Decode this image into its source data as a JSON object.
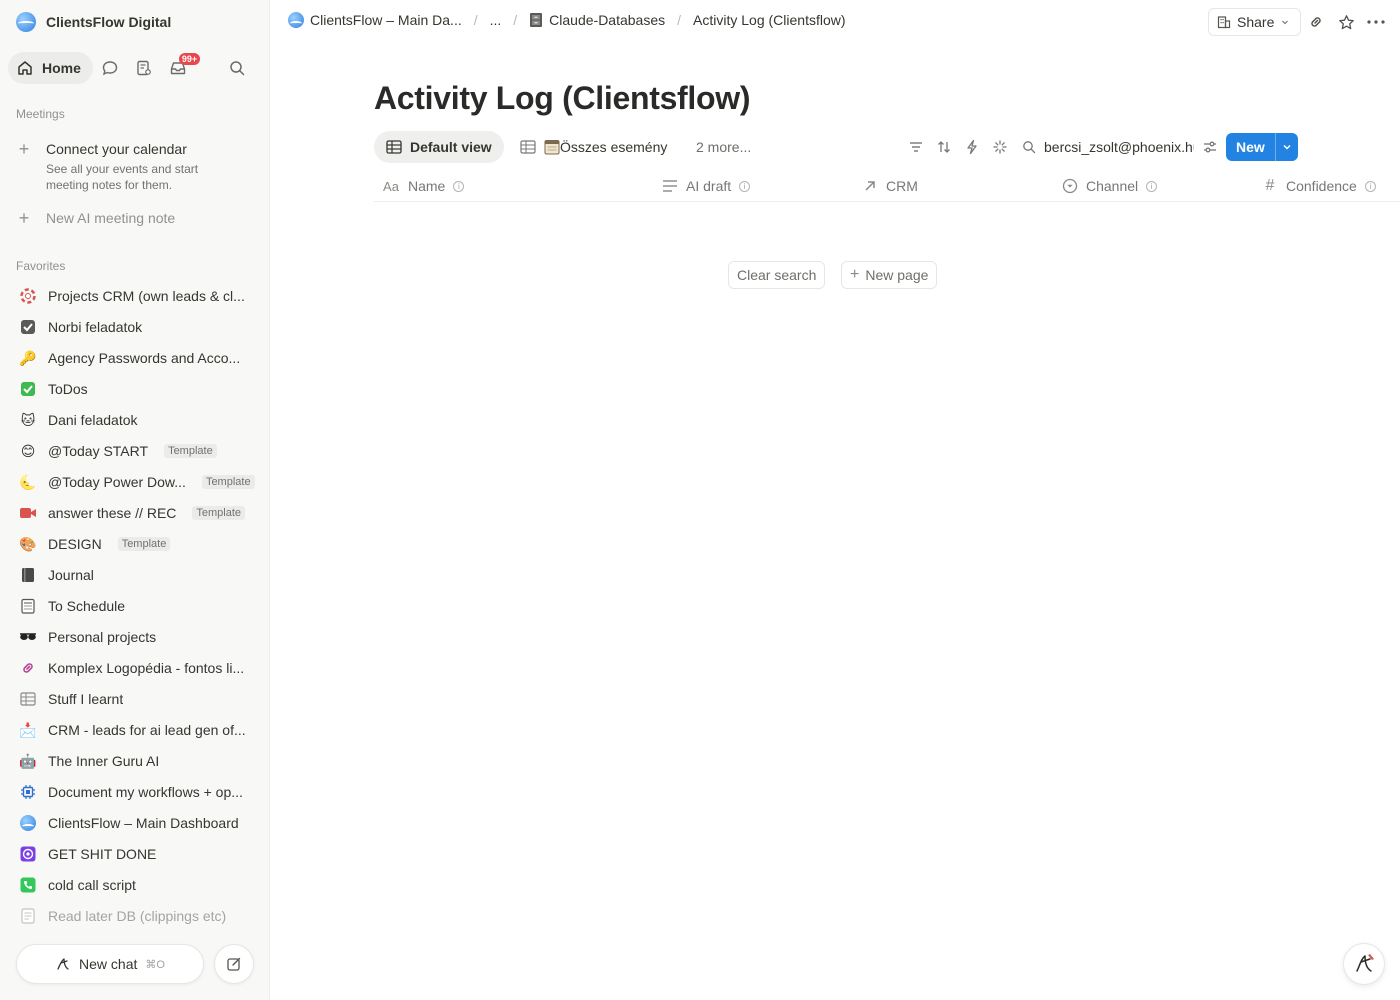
{
  "workspace": {
    "name": "ClientsFlow Digital"
  },
  "nav": {
    "home_label": "Home",
    "inbox_badge": "99+"
  },
  "meetings": {
    "section_label": "Meetings",
    "connect_title": "Connect your calendar",
    "connect_desc": "See all your events and start meeting notes for them.",
    "new_note": "New AI meeting note"
  },
  "favorites": {
    "section_label": "Favorites",
    "template_tag": "Template",
    "items": [
      {
        "label": "Projects CRM (own leads & cl...",
        "icon": "lifebuoy-icon"
      },
      {
        "label": "Norbi feladatok",
        "icon": "checkbox-icon"
      },
      {
        "label": "Agency Passwords and Acco...",
        "icon": "key-icon"
      },
      {
        "label": "ToDos",
        "icon": "check-mark-icon"
      },
      {
        "label": "Dani feladatok",
        "icon": "cat-icon"
      },
      {
        "label": "@Today START",
        "icon": "smile-icon"
      },
      {
        "label": "@Today Power Dow...",
        "icon": "moon-icon"
      },
      {
        "label": "answer these // REC",
        "icon": "video-camera-icon"
      },
      {
        "label": "DESIGN",
        "icon": "palette-icon"
      },
      {
        "label": "Journal",
        "icon": "notebook-icon"
      },
      {
        "label": "To Schedule",
        "icon": "calendar-icon"
      },
      {
        "label": "Personal projects",
        "icon": "sunglasses-icon"
      },
      {
        "label": "Komplex Logopédia - fontos li...",
        "icon": "link-icon"
      },
      {
        "label": "Stuff I learnt",
        "icon": "table-icon"
      },
      {
        "label": "CRM - leads for ai lead gen of...",
        "icon": "inbox-tray-icon"
      },
      {
        "label": "The Inner Guru AI",
        "icon": "robot-icon"
      },
      {
        "label": "Document my workflows + op...",
        "icon": "chip-icon"
      },
      {
        "label": "ClientsFlow – Main Dashboard",
        "icon": "clientsflow-logo-icon"
      },
      {
        "label": "GET SHIT DONE",
        "icon": "target-icon"
      },
      {
        "label": "cold call script",
        "icon": "phone-icon"
      },
      {
        "label": "Read later DB (clippings etc)",
        "icon": "document-icon"
      }
    ]
  },
  "newchat": {
    "label": "New chat",
    "shortcut": "⌘O"
  },
  "breadcrumb": {
    "item1": "ClientsFlow – Main Da...",
    "ellipsis": "...",
    "item2": "Claude-Databases",
    "item3": "Activity Log (Clientsflow)"
  },
  "topbar": {
    "share_label": "Share"
  },
  "page": {
    "title": "Activity Log (Clientsflow)"
  },
  "views": {
    "default": "Default view",
    "second": "Összes esemény",
    "more": "2 more..."
  },
  "search": {
    "value": "bercsi_zsolt@phoenix.hu"
  },
  "new_button": "New",
  "columns": [
    "Name",
    "AI draft",
    "CRM",
    "Channel",
    "Confidence"
  ],
  "empty": {
    "clear_search": "Clear search",
    "new_page": "New page"
  },
  "colors": {
    "accent": "#2383e2",
    "badge": "#e5484d",
    "sidebar_bg": "#f8f8f7"
  }
}
